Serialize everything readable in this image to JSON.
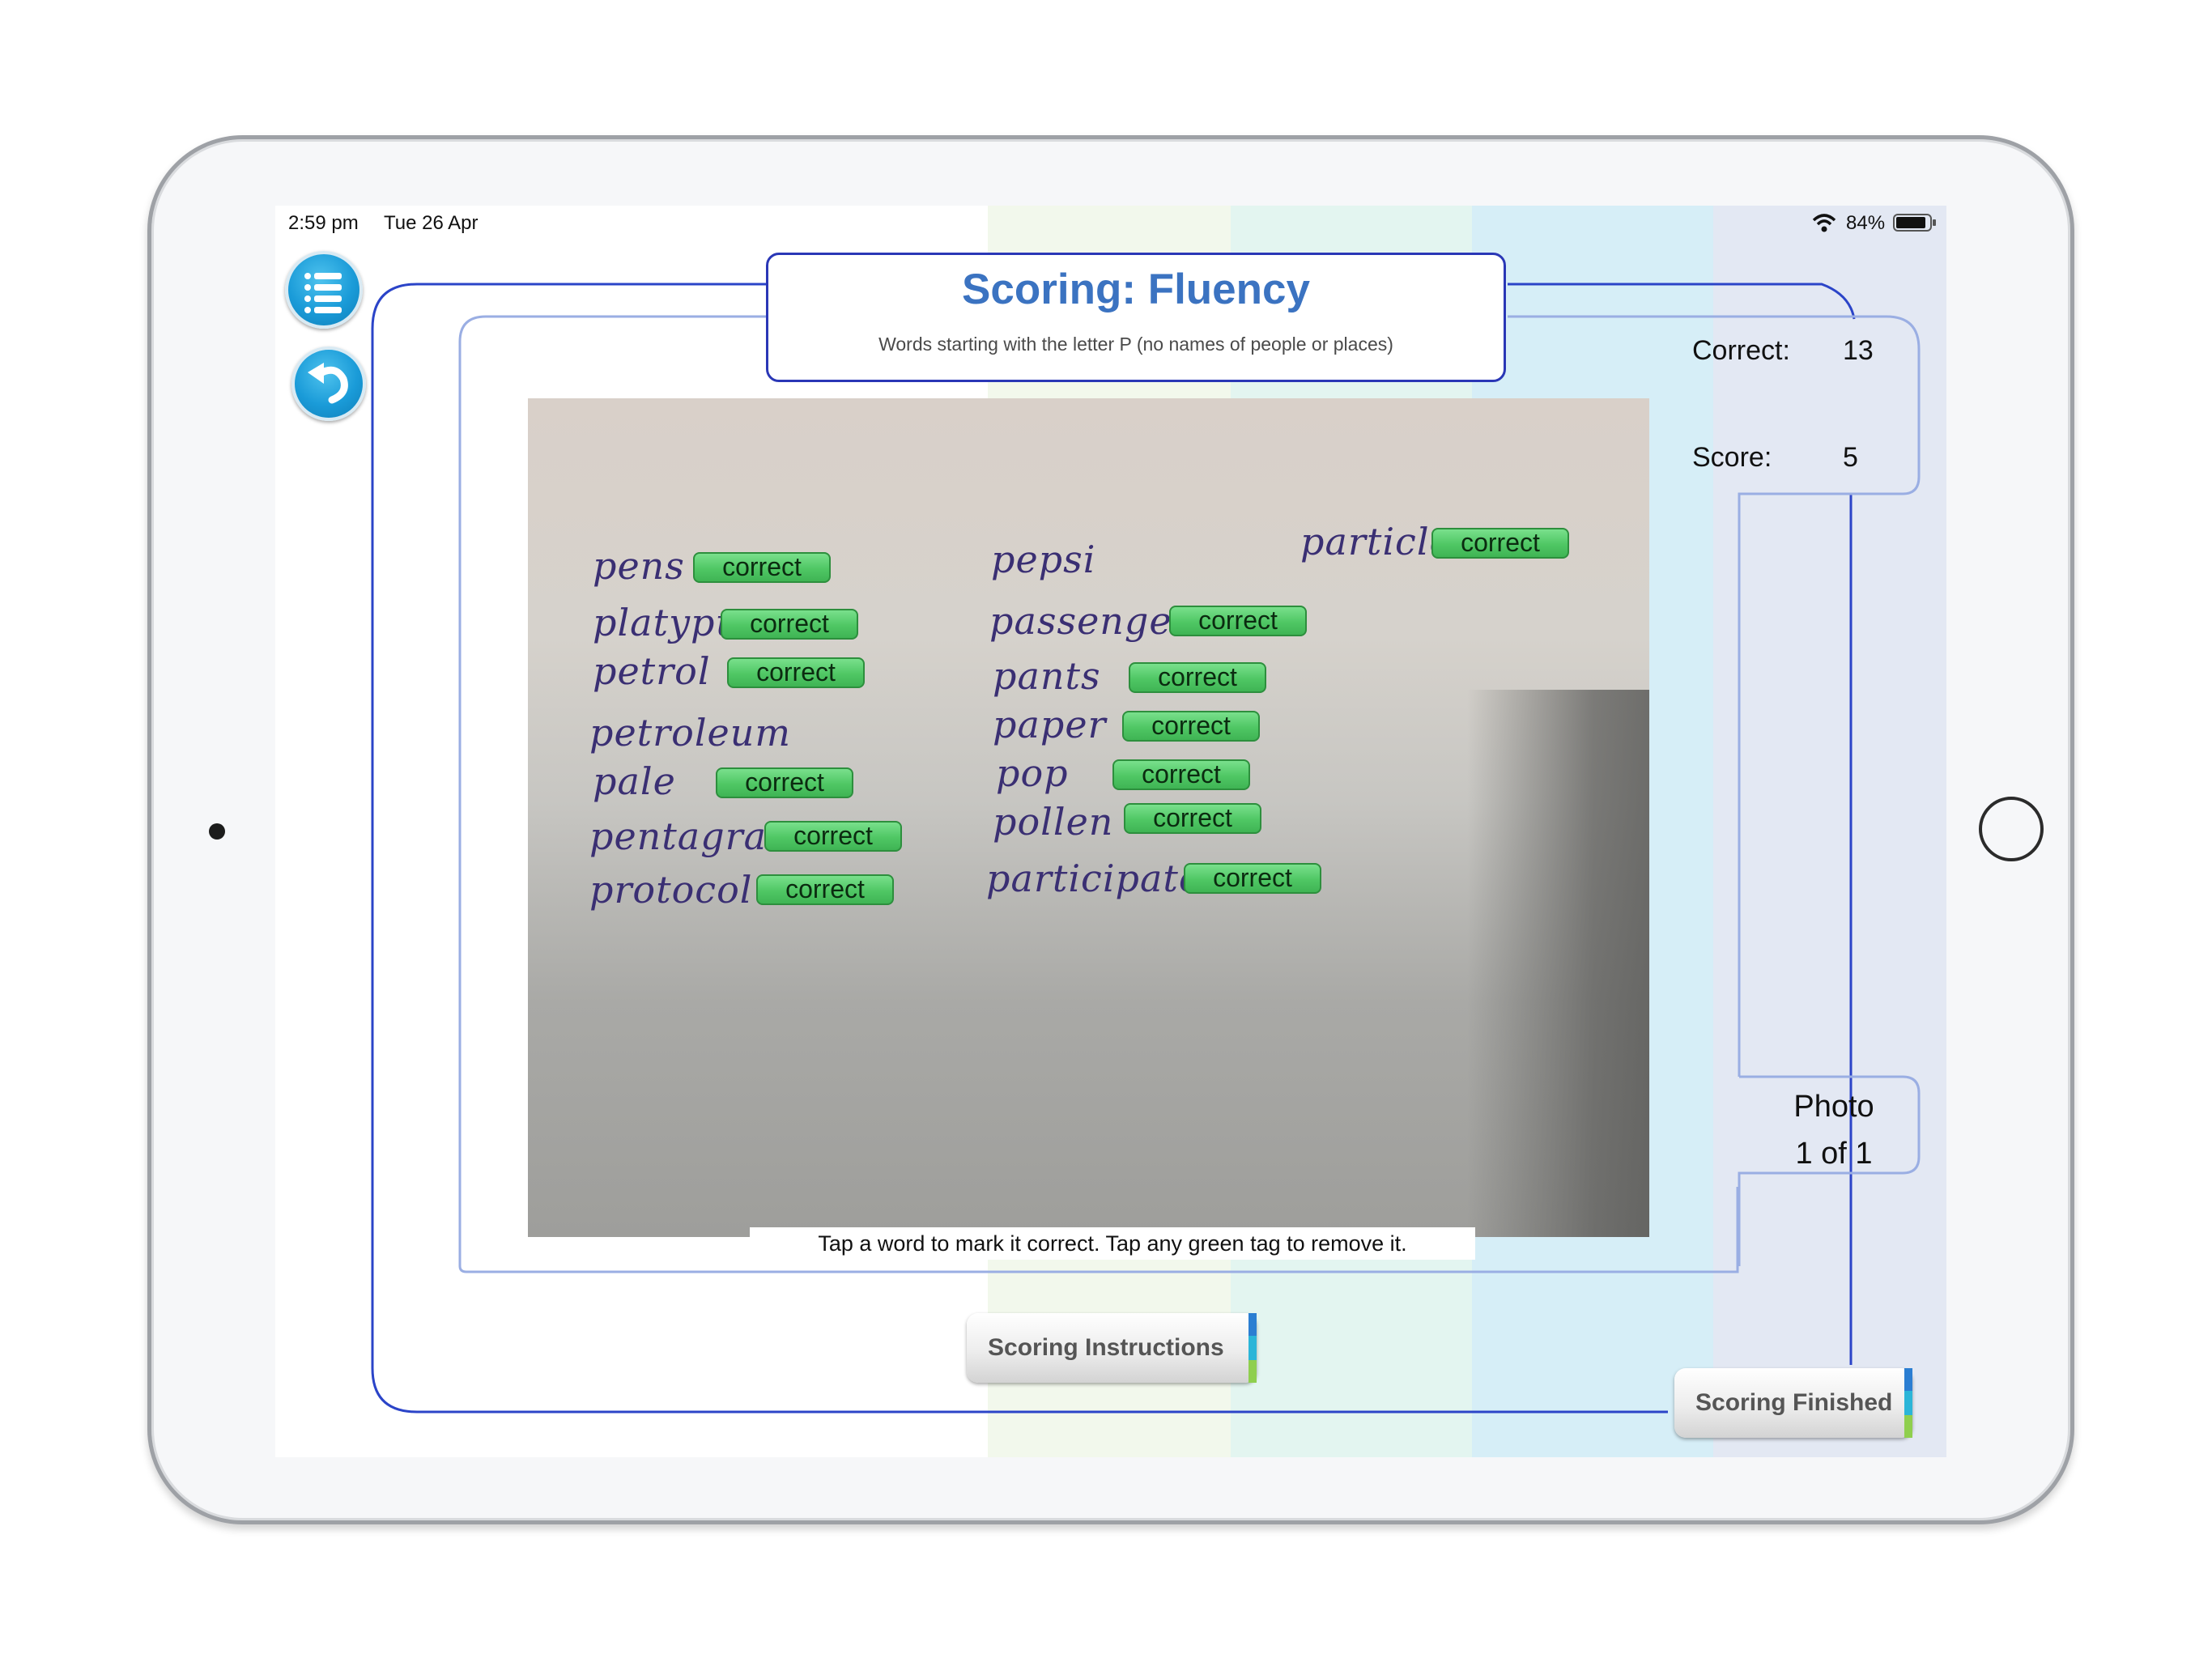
{
  "status_bar": {
    "time": "2:59 pm",
    "date": "Tue 26 Apr",
    "battery_percent": "84%",
    "wifi_icon": "wifi-icon",
    "battery_icon": "battery-icon"
  },
  "header": {
    "title": "Scoring: Fluency",
    "subtitle": "Words starting with the letter P (no names of people or places)"
  },
  "side_buttons": {
    "menu_icon": "list-icon",
    "undo_icon": "undo-icon"
  },
  "scores": {
    "correct_label": "Correct:",
    "correct_value": "13",
    "score_label": "Score:",
    "score_value": "5"
  },
  "photo": {
    "tag_text": "correct",
    "column1": [
      "pens",
      "platypus",
      "petrol",
      "petroleum",
      "pale",
      "pentagram",
      "protocol"
    ],
    "column2": [
      "pepsi",
      "passenger",
      "pants",
      "paper",
      "pop",
      "pollen",
      "participate"
    ],
    "column3": [
      "particle"
    ],
    "hint": "Tap a word to mark it correct. Tap any green tag to remove it."
  },
  "photo_counter": {
    "label": "Photo",
    "position": "1 of 1"
  },
  "buttons": {
    "instructions": "Scoring Instructions",
    "finished": "Scoring Finished"
  },
  "colors": {
    "accent_blue": "#3b73c1",
    "frame_blue": "#2a37b6",
    "tag_green": "#4fc764"
  }
}
